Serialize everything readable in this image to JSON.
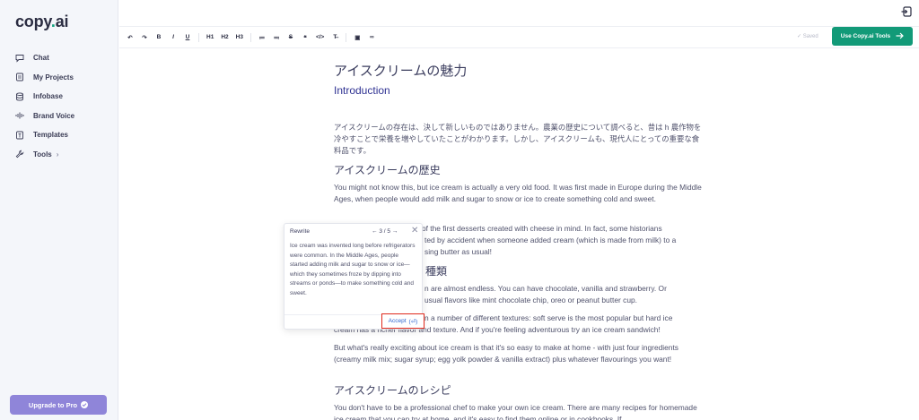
{
  "app": {
    "logo_text": "copy",
    "logo_dot": ".",
    "logo_suffix": "ai"
  },
  "sidebar": {
    "items": [
      {
        "label": "Chat",
        "icon": "chat-icon"
      },
      {
        "label": "My Projects",
        "icon": "projects-icon"
      },
      {
        "label": "Infobase",
        "icon": "database-icon"
      },
      {
        "label": "Brand Voice",
        "icon": "soundwave-icon"
      },
      {
        "label": "Templates",
        "icon": "templates-icon"
      },
      {
        "label": "Tools",
        "icon": "wrench-icon"
      }
    ],
    "upgrade_label": "Upgrade to Pro"
  },
  "toolbar": {
    "buttons": [
      "↶",
      "↷",
      "B",
      "I",
      "U",
      "H1",
      "H2",
      "H3",
      "≔",
      "≕",
      "S",
      "❝",
      "</>",
      "T̶",
      "▣",
      "∞"
    ],
    "saved_label": "Saved",
    "cta_label": "Use Copy.ai Tools"
  },
  "document": {
    "title": "アイスクリームの魅力",
    "intro_heading": "Introduction",
    "intro_para": "アイスクリームの存在は、決して新しいものではありません。農業の歴史について調べると、昔は h 農作物を冷やすことで栄養を増やしていたことがわかります。しかし、アイスクリームも、現代人にとっての重要な食料品です。",
    "history_heading": "アイスクリームの歴史",
    "history_para": "You might not know this, but ice cream is actually a very old food. It was first made in Europe during the Middle Ages, when people would add milk and sugar to snow or ice to create something cold and sweet.",
    "history_para2_line1": "of the first desserts created with cheese in mind. In fact, some historians",
    "history_para2_line2": "ted by accident when someone added cream (which is made from milk) to a",
    "history_para2_line3": "sing butter as usual!",
    "types_heading_fragment": "種類",
    "types_para_line1": "n are almost endless. You can have chocolate, vanilla and strawberry. Or",
    "types_para_line2": "usual flavors like mint chocolate chip, oreo or peanut butter cup.",
    "texture_para_line1": "n a number of different textures: soft serve is the most popular but hard ice",
    "texture_para_line2": "cream has a richer flavor and texture. And if you're feeling adventurous try an ice cream sandwich!",
    "home_para": "But what's really exciting about ice cream is that it's so easy to make at home - with just four ingredients (creamy milk mix; sugar syrup; egg yolk powder & vanilla extract) plus whatever flavourings you want!",
    "recipe_heading": "アイスクリームのレシピ",
    "recipe_para": "You don't have to be a professional chef to make your own ice cream. There are many recipes for homemade ice cream that you can try at home, and it's easy to find them online or in cookbooks. If"
  },
  "rewrite_popup": {
    "title": "Rewrite",
    "pager": "3 / 5",
    "body": "Ice cream was invented long before refrigerators were common. In the Middle Ages, people started adding milk and sugar to snow or ice—which they sometimes froze by dipping into streams or ponds—to make something cold and sweet.",
    "accept_label": "Accept"
  },
  "colors": {
    "accent": "#129a78",
    "upgrade": "#8f85d9",
    "heading_blue": "#2e3192",
    "highlight_box": "#e0291c"
  }
}
